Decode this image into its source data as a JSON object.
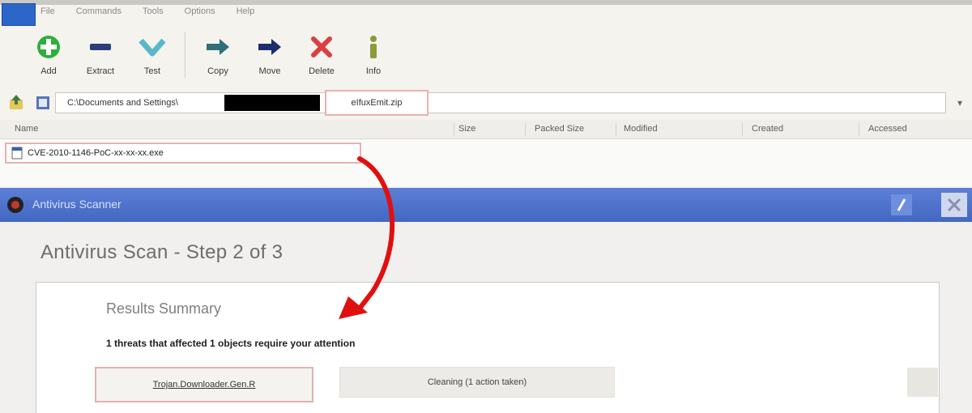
{
  "archiver": {
    "app_icon_label": "",
    "menu": [
      "File",
      "Commands",
      "Tools",
      "Options",
      "Help"
    ],
    "toolbar": [
      {
        "label": "Add",
        "icon": "add-icon",
        "color": "#2fae3b"
      },
      {
        "label": "Extract",
        "icon": "extract-icon",
        "color": "#2b3d7a"
      },
      {
        "label": "Test",
        "icon": "test-icon",
        "color": "#58b8c8"
      },
      {
        "label": "Copy",
        "icon": "copy-icon",
        "color": "#2d6f7a"
      },
      {
        "label": "Move",
        "icon": "move-icon",
        "color": "#1e2d6d"
      },
      {
        "label": "Delete",
        "icon": "delete-icon",
        "color": "#d94040"
      },
      {
        "label": "Info",
        "icon": "info-icon",
        "color": "#8d9a3a"
      }
    ],
    "path": {
      "prefix": "C:\\Documents and Settings\\",
      "file": "eIfuxEmit.zip"
    },
    "columns": [
      "Name",
      "Size",
      "Packed Size",
      "Modified",
      "Created",
      "Accessed"
    ],
    "files": [
      {
        "name": "CVE-2010-1146-PoC-xx-xx-xx.exe"
      }
    ]
  },
  "antivirus": {
    "title": "Antivirus Scanner",
    "step_title": "Antivirus Scan - Step 2 of 3",
    "summary_heading": "Results Summary",
    "summary_text": "1 threats that affected 1 objects require your attention",
    "object_label": "Trojan.Downloader.Gen.R",
    "action_text": "Cleaning (1 action taken)"
  },
  "colors": {
    "accent_blue": "#4a6fcc",
    "highlight_border": "#e8b1b1",
    "arrow_red": "#e01010"
  }
}
